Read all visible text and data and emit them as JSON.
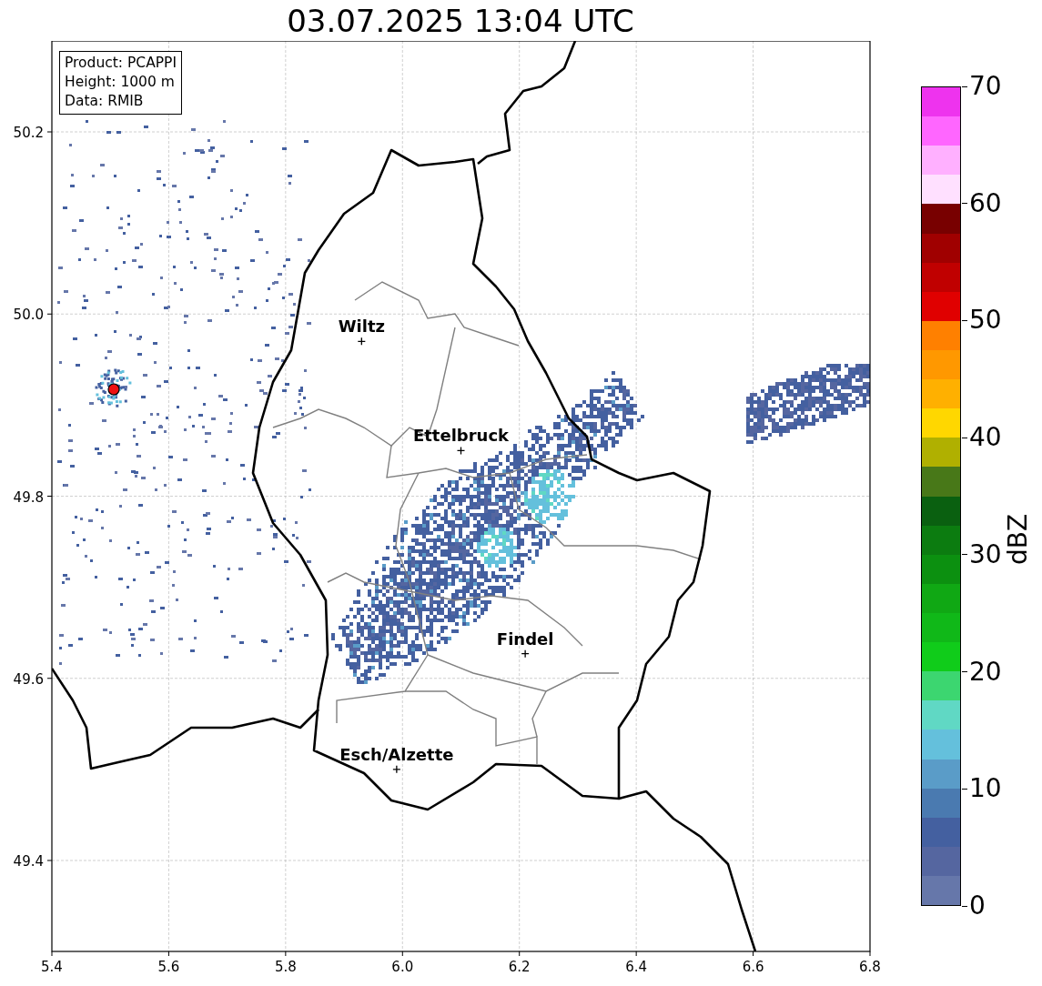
{
  "title": "03.07.2025 13:04 UTC",
  "info_box": [
    "Product: PCAPPI",
    "Height: 1000 m",
    "Data: RMIB"
  ],
  "map": {
    "x_ticks": [
      "5.4",
      "5.6",
      "5.8",
      "6.0",
      "6.2",
      "6.4",
      "6.6",
      "6.8"
    ],
    "y_ticks": [
      "50.2",
      "50.0",
      "49.8",
      "49.6",
      "49.4"
    ],
    "cities": [
      {
        "name": "Wiltz"
      },
      {
        "name": "Ettelbruck"
      },
      {
        "name": "Findel"
      },
      {
        "name": "Esch/Alzette"
      }
    ]
  },
  "colorbar": {
    "label": "dBZ",
    "ticks": [
      "70",
      "60",
      "50",
      "40",
      "30",
      "20",
      "10",
      "0"
    ],
    "bands": [
      {
        "color": "#ee33ee"
      },
      {
        "color": "#ff66ff"
      },
      {
        "color": "#ffb0ff"
      },
      {
        "color": "#ffe0ff"
      },
      {
        "color": "#780000"
      },
      {
        "color": "#a00000"
      },
      {
        "color": "#c00000"
      },
      {
        "color": "#e00000"
      },
      {
        "color": "#ff8000"
      },
      {
        "color": "#ff9800"
      },
      {
        "color": "#ffb000"
      },
      {
        "color": "#ffd700"
      },
      {
        "color": "#b0b000"
      },
      {
        "color": "#487818"
      },
      {
        "color": "#0a6010"
      },
      {
        "color": "#0c7c10"
      },
      {
        "color": "#0c9010"
      },
      {
        "color": "#10a814"
      },
      {
        "color": "#10b818"
      },
      {
        "color": "#10cc1a"
      },
      {
        "color": "#3cd670"
      },
      {
        "color": "#60d8c4"
      },
      {
        "color": "#64c0dc"
      },
      {
        "color": "#5a9cc8"
      },
      {
        "color": "#4a7ab0"
      },
      {
        "color": "#4460a0"
      },
      {
        "color": "#5566a0"
      },
      {
        "color": "#6677aa"
      }
    ]
  }
}
